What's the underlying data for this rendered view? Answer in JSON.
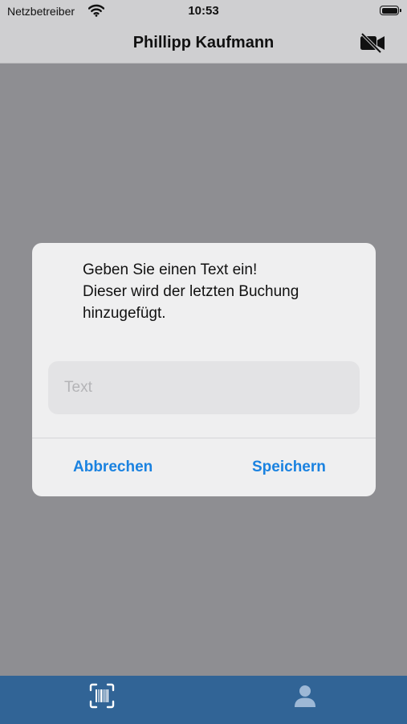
{
  "status_bar": {
    "carrier": "Netzbetreiber",
    "time": "10:53",
    "icons": [
      "wifi-icon",
      "battery-icon"
    ]
  },
  "nav_bar": {
    "title": "Phillipp Kaufmann",
    "right_icon": "video-off-icon"
  },
  "dialog": {
    "message_lines": [
      "Geben Sie einen Text ein!",
      "Dieser wird der letzten Buchung",
      "hinzugefügt."
    ],
    "input": {
      "placeholder": "Text",
      "value": ""
    },
    "cancel_label": "Abbrechen",
    "save_label": "Speichern"
  },
  "tab_bar": {
    "items": [
      {
        "icon": "barcode-scan-icon",
        "selected": true
      },
      {
        "icon": "person-icon",
        "selected": false
      }
    ]
  },
  "colors": {
    "accent": "#1a82e0",
    "tab_bar": "#316496",
    "overlay": "#8e8e92",
    "dialog_bg": "#efeff0"
  }
}
